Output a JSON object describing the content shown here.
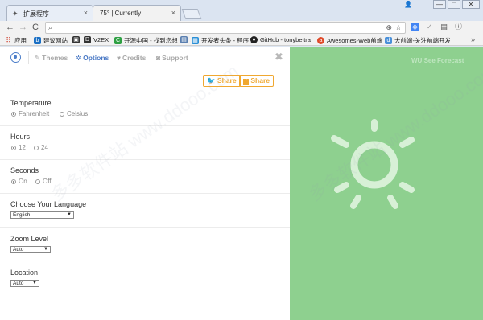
{
  "tabs": [
    {
      "title": "扩展程序",
      "close": "×"
    },
    {
      "title": "75° | Currently",
      "close": "×"
    }
  ],
  "window_controls": {
    "minimize": "—",
    "maximize": "□",
    "close": "✕"
  },
  "toolbar": {
    "back": "←",
    "forward": "→",
    "reload": "C",
    "url": ""
  },
  "bookmarks": [
    {
      "label": "应用",
      "icon": "apps-grid-icon",
      "color": "#d04a3a"
    },
    {
      "label": "建议网站",
      "icon": "suggest-icon",
      "color": "#1a6fc4"
    },
    {
      "label": "",
      "icon": "page-icon",
      "color": "#333333"
    },
    {
      "label": "V2EX",
      "icon": "v2ex-icon",
      "color": "#333333"
    },
    {
      "label": "开源中国 - 找到您想",
      "icon": "oschina-icon",
      "color": "#2ea043"
    },
    {
      "label": "",
      "icon": "doc-icon",
      "color": "#5a7fb0"
    },
    {
      "label": "开发者头条 - 程序员",
      "icon": "toutiao-icon",
      "color": "#2a8fd6"
    },
    {
      "label": "GitHub - tonybeltra",
      "icon": "github-icon",
      "color": "#222222"
    },
    {
      "label": "Awesomes-Web前端",
      "icon": "awesomes-icon",
      "color": "#e04a2a"
    },
    {
      "label": "大前端-关注前端开发",
      "icon": "dqd-icon",
      "color": "#4a90d9"
    }
  ],
  "bookmarks_more": "»",
  "panel": {
    "nav": [
      {
        "label": "Themes",
        "icon": "brush-icon",
        "active": false
      },
      {
        "label": "Options",
        "icon": "gear-icon",
        "active": true
      },
      {
        "label": "Credits",
        "icon": "heart-icon",
        "active": false
      },
      {
        "label": "Support",
        "icon": "camera-icon",
        "active": false
      }
    ],
    "close": "✖",
    "share_twitter": "Share",
    "share_facebook": "Share",
    "settings": {
      "temperature": {
        "label": "Temperature",
        "options": [
          "Fahrenheit",
          "Celsius"
        ],
        "selected": 0
      },
      "hours": {
        "label": "Hours",
        "options": [
          "12",
          "24"
        ],
        "selected": 0
      },
      "seconds": {
        "label": "Seconds",
        "options": [
          "On",
          "Off"
        ],
        "selected": 0
      },
      "language": {
        "label": "Choose Your Language",
        "value": "English"
      },
      "zoom": {
        "label": "Zoom Level",
        "value": "Auto"
      },
      "location": {
        "label": "Location",
        "value": "Auto"
      }
    }
  },
  "preview": {
    "wu_label": "See Forecast",
    "wu_logo": "WU",
    "icon": "sun-icon",
    "bg_color": "#8ed08f"
  },
  "watermark": "多多软件站  www.ddooo.com"
}
